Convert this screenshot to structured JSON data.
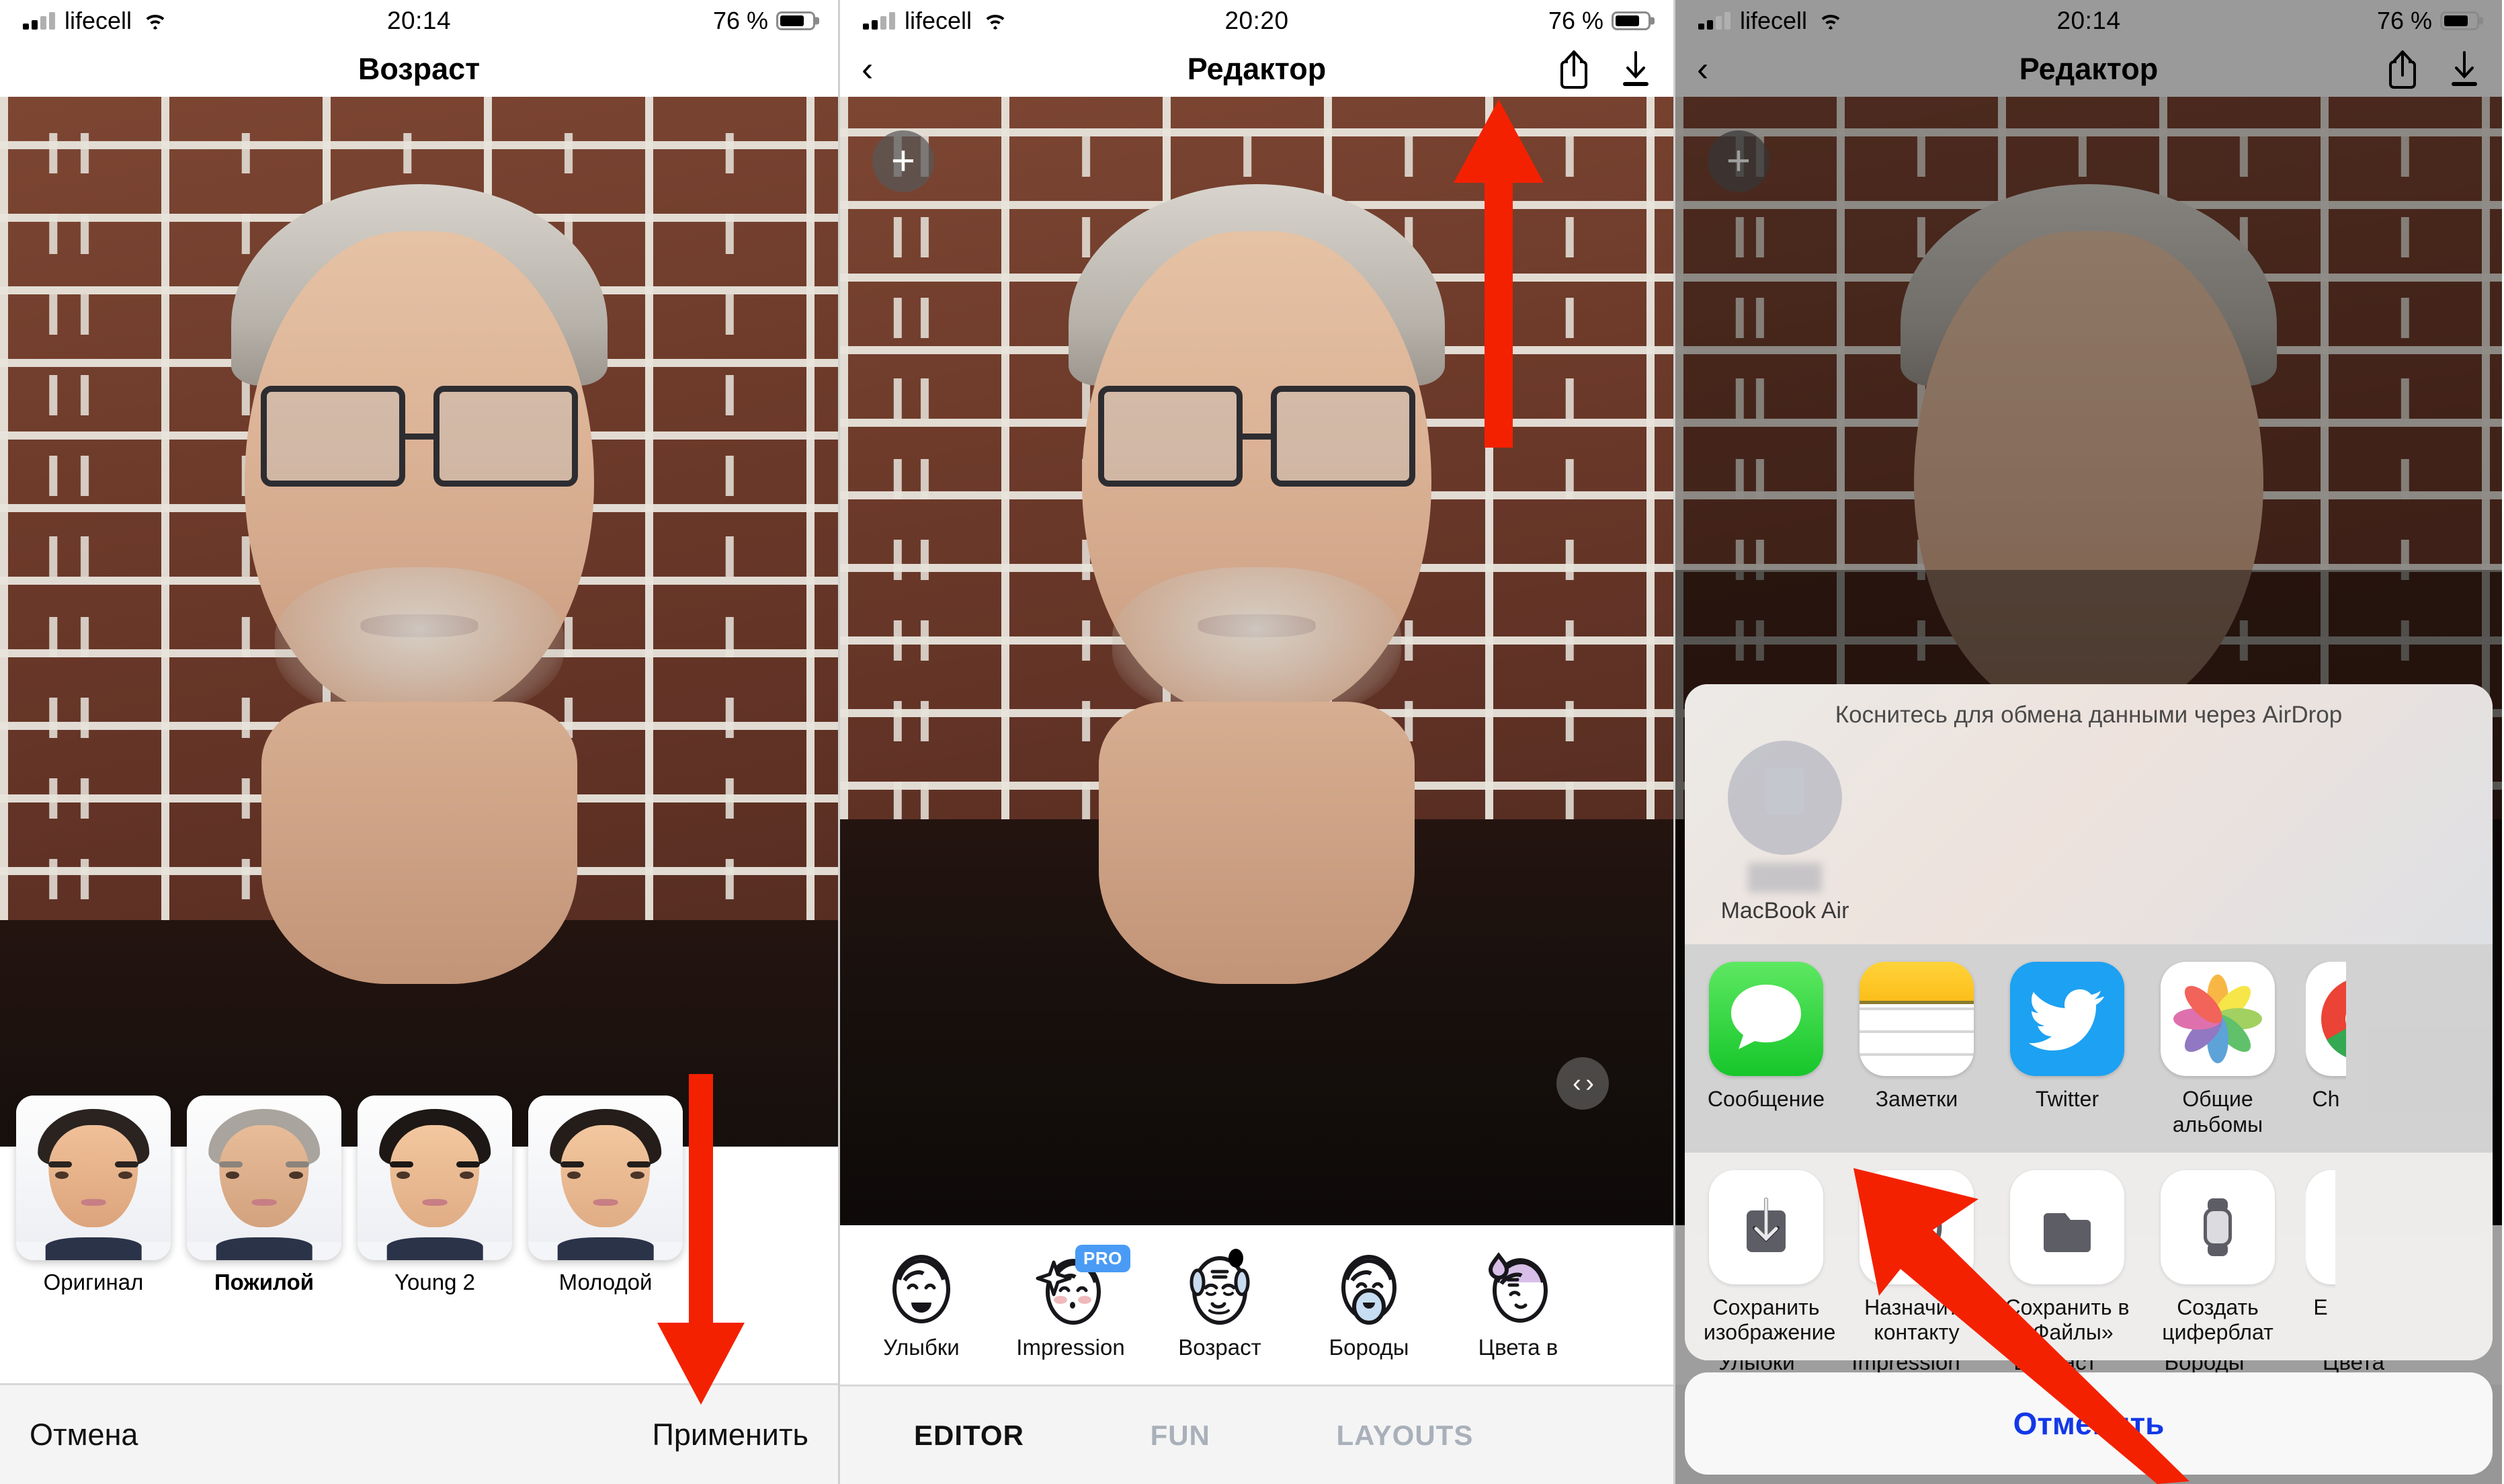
{
  "panels": [
    {
      "id": "age-editor",
      "status": {
        "carrier": "lifecell",
        "time": "20:14",
        "battery": "76 %",
        "signal_icon": "cellular-bars-icon",
        "wifi_icon": "wifi-icon",
        "battery_icon": "battery-icon"
      },
      "nav": {
        "title": "Возраст"
      },
      "thumbs": [
        {
          "label": "Оригинал",
          "active": false
        },
        {
          "label": "Пожилой",
          "active": true
        },
        {
          "label": "Young 2",
          "active": false
        },
        {
          "label": "Молодой",
          "active": false
        }
      ],
      "bottom": {
        "cancel": "Отмена",
        "apply": "Применить"
      },
      "handle_icon": "resize-handle-icon"
    },
    {
      "id": "editor",
      "status": {
        "carrier": "lifecell",
        "time": "20:20",
        "battery": "76 %",
        "signal_icon": "cellular-bars-icon",
        "wifi_icon": "wifi-icon",
        "battery_icon": "battery-icon"
      },
      "nav": {
        "back_icon": "chevron-left-icon",
        "title": "Редактор",
        "share_icon": "share-up-icon",
        "download_icon": "download-icon"
      },
      "add_button_icon": "plus-icon",
      "handle_icon": "resize-handle-icon",
      "tools": [
        {
          "label": "Улыбки",
          "icon": "smile-face-icon",
          "badge": ""
        },
        {
          "label": "Impression",
          "icon": "sparkle-face-icon",
          "badge": "PRO"
        },
        {
          "label": "Возраст",
          "icon": "old-face-icon",
          "badge": "dot"
        },
        {
          "label": "Бороды",
          "icon": "beard-face-icon",
          "badge": ""
        },
        {
          "label": "Цвета в",
          "icon": "hair-color-face-icon",
          "badge": ""
        }
      ],
      "tabs": [
        {
          "label": "EDITOR",
          "active": true
        },
        {
          "label": "FUN",
          "active": false
        },
        {
          "label": "LAYOUTS",
          "active": false
        }
      ]
    },
    {
      "id": "share-sheet",
      "status": {
        "carrier": "lifecell",
        "time": "20:14",
        "battery": "76 %",
        "signal_icon": "cellular-bars-icon",
        "wifi_icon": "wifi-icon",
        "battery_icon": "battery-icon"
      },
      "nav": {
        "back_icon": "chevron-left-icon",
        "title": "Редактор",
        "share_icon": "share-up-icon",
        "download_icon": "download-icon"
      },
      "add_button_icon": "plus-icon",
      "sheet": {
        "airdrop_title": "Коснитесь для обмена данными через AirDrop",
        "airdrop_device": "MacBook Air",
        "apps": [
          {
            "label": "Сообщение",
            "icon": "messages-icon"
          },
          {
            "label": "Заметки",
            "icon": "notes-icon"
          },
          {
            "label": "Twitter",
            "icon": "twitter-icon"
          },
          {
            "label": "Общие\nальбомы",
            "icon": "photos-icon"
          },
          {
            "label": "Ch",
            "icon": "chrome-icon"
          }
        ],
        "actions": [
          {
            "label": "Сохранить\nизображение",
            "icon": "save-image-icon"
          },
          {
            "label": "Назначить\nконтакту",
            "icon": "assign-contact-icon"
          },
          {
            "label": "Сохранить в\n«Файлы»",
            "icon": "folder-icon"
          },
          {
            "label": "Создать\nциферблат",
            "icon": "watch-face-icon"
          },
          {
            "label": "Е",
            "icon": "more-icon"
          }
        ],
        "cancel": "Отменить"
      },
      "ghost_tools": [
        "Улыбки",
        "Impression",
        "Возраст",
        "Бороды",
        "Цвета"
      ]
    }
  ],
  "annotations": {
    "arrow_color": "#f42100",
    "arrows": [
      {
        "name": "arrow-to-share-button",
        "direction": "up"
      },
      {
        "name": "arrow-to-apply-button",
        "direction": "down"
      },
      {
        "name": "arrow-to-save-image",
        "direction": "up-left"
      }
    ]
  }
}
